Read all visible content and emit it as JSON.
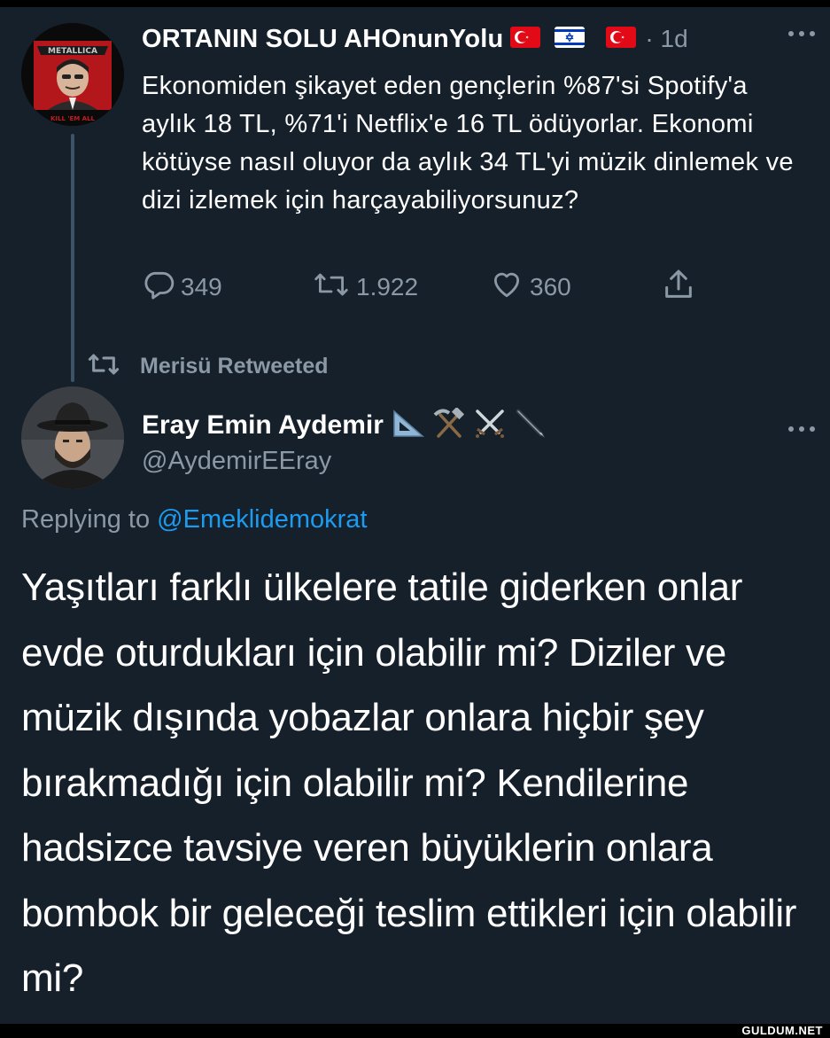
{
  "parent_tweet": {
    "author_name": "ORTANIN SOLU AHOnunYolu",
    "timestamp": "· 1d",
    "text": "Ekonomiden şikayet eden gençlerin %87'si Spotify'a aylık 18 TL, %71'i Netflix'e 16 TL ödüyorlar. Ekonomi kötüyse nasıl oluyor da aylık 34 TL'yi müzik dinlemek ve dizi izlemek için harçayabiliyorsunuz?",
    "avatar_text": "KILL 'EM ALL",
    "replies": "349",
    "retweets": "1.922",
    "likes": "360"
  },
  "retweet_context": {
    "label": "Merisü Retweeted"
  },
  "reply_tweet": {
    "author_name": "Eray Emin Aydemir",
    "handle": "@AydemirEEray",
    "replying_prefix": "Replying to ",
    "replying_to": "@Emeklidemokrat",
    "text": "Yaşıtları farklı ülkelere tatile giderken onlar evde oturdukları için olabilir mi? Diziler ve müzik dışında yobazlar onlara hiçbir şey bırakmadığı için olabilir mi? Kendilerine hadsizce tavsiye veren büyüklerin onlara bombok bir geleceği teslim ettikleri için olabilir mi?"
  },
  "watermark": "GULDUM.NET",
  "colors": {
    "background": "#15202b",
    "text_primary": "#ffffff",
    "text_secondary": "#8b98a5",
    "accent": "#1d9bf0",
    "turkish_flag": "#e30a17",
    "israel_blue": "#0038b8"
  },
  "icons": {
    "reply": "reply-icon",
    "retweet": "retweet-icon",
    "like": "heart-icon",
    "share": "share-icon",
    "more": "more-options-icon"
  }
}
